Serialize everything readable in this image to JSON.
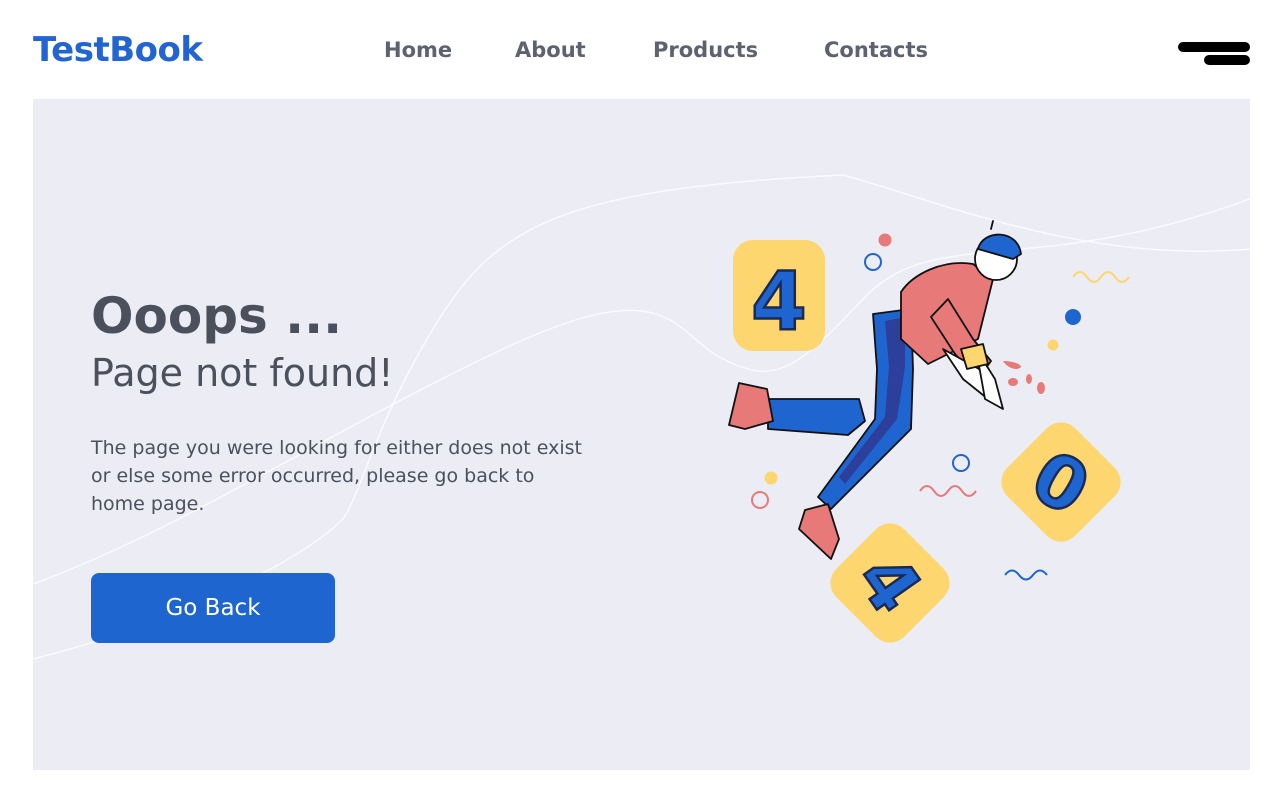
{
  "brand": {
    "logo": "TestBook"
  },
  "nav": {
    "items": [
      "Home",
      "About",
      "Products",
      "Contacts"
    ]
  },
  "hero": {
    "title": "Ooops ...",
    "subtitle": "Page not found!",
    "description": "The page you were looking for either does not exist or else some error occurred, please go back to home page.",
    "button_label": "Go Back"
  },
  "illustration": {
    "digits": [
      "4",
      "0",
      "4"
    ]
  },
  "colors": {
    "brand_blue": "#1f65d0",
    "hero_bg": "#ebecf4",
    "tile_yellow": "#fdd670",
    "accent_red": "#e77a78",
    "text_dark": "#4b505d"
  }
}
